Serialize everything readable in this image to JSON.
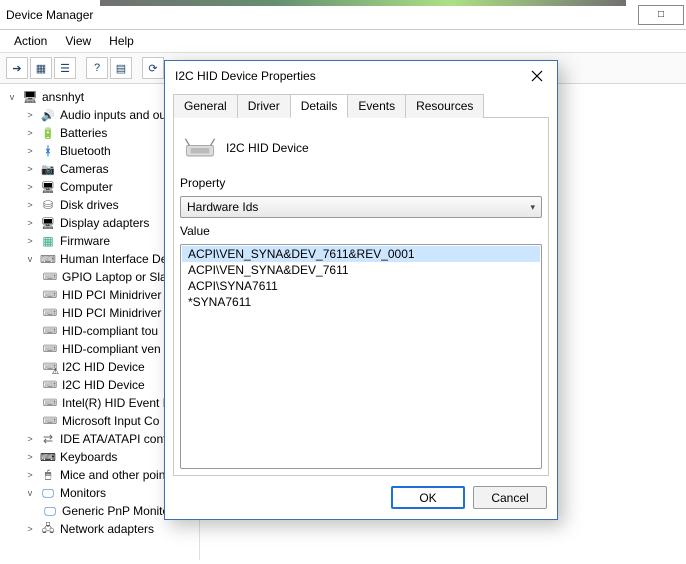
{
  "window": {
    "title": "Device Manager",
    "rightbox": "□"
  },
  "menus": {
    "action": "Action",
    "view": "View",
    "help": "Help"
  },
  "tree": {
    "root": {
      "label": "ansnhyt"
    },
    "items": [
      {
        "label": "Audio inputs and outp",
        "exp": ">",
        "icon": "ic-audio"
      },
      {
        "label": "Batteries",
        "exp": ">",
        "icon": "ic-batt"
      },
      {
        "label": "Bluetooth",
        "exp": ">",
        "icon": "ic-bt"
      },
      {
        "label": "Cameras",
        "exp": ">",
        "icon": "ic-cam"
      },
      {
        "label": "Computer",
        "exp": ">",
        "icon": "ic-comp"
      },
      {
        "label": "Disk drives",
        "exp": ">",
        "icon": "ic-disk"
      },
      {
        "label": "Display adapters",
        "exp": ">",
        "icon": "ic-disp"
      },
      {
        "label": "Firmware",
        "exp": ">",
        "icon": "ic-firm"
      },
      {
        "label": "Human Interface Devic",
        "exp": "v",
        "icon": "ic-hid",
        "children": [
          {
            "label": "GPIO Laptop or Slat",
            "icon": "ic-hidl"
          },
          {
            "label": "HID PCI Minidriver",
            "icon": "ic-hidl"
          },
          {
            "label": "HID PCI Minidriver",
            "icon": "ic-hidl"
          },
          {
            "label": "HID-compliant tou",
            "icon": "ic-hidl"
          },
          {
            "label": "HID-compliant ven",
            "icon": "ic-hidl"
          },
          {
            "label": "I2C HID Device",
            "icon": "ic-warn"
          },
          {
            "label": "I2C HID Device",
            "icon": "ic-hidl"
          },
          {
            "label": "Intel(R) HID Event P",
            "icon": "ic-hidl"
          },
          {
            "label": "Microsoft Input Co",
            "icon": "ic-hidl"
          }
        ]
      },
      {
        "label": "IDE ATA/ATAPI controll",
        "exp": ">",
        "icon": "ic-ide"
      },
      {
        "label": "Keyboards",
        "exp": ">",
        "icon": "ic-kb"
      },
      {
        "label": "Mice and other pointin",
        "exp": ">",
        "icon": "ic-mouse"
      },
      {
        "label": "Monitors",
        "exp": "v",
        "icon": "ic-mon",
        "children": [
          {
            "label": "Generic PnP Monito",
            "icon": "ic-mon"
          }
        ]
      },
      {
        "label": "Network adapters",
        "exp": ">",
        "icon": "ic-net"
      }
    ]
  },
  "dialog": {
    "title": "I2C HID Device Properties",
    "device_name": "I2C HID Device",
    "tabs": {
      "general": "General",
      "driver": "Driver",
      "details": "Details",
      "events": "Events",
      "resources": "Resources"
    },
    "prop_label": "Property",
    "dropdown": "Hardware Ids",
    "value_label": "Value",
    "values": [
      "ACPI\\VEN_SYNA&DEV_7611&REV_0001",
      "ACPI\\VEN_SYNA&DEV_7611",
      "ACPI\\SYNA7611",
      "*SYNA7611"
    ],
    "ok": "OK",
    "cancel": "Cancel"
  }
}
